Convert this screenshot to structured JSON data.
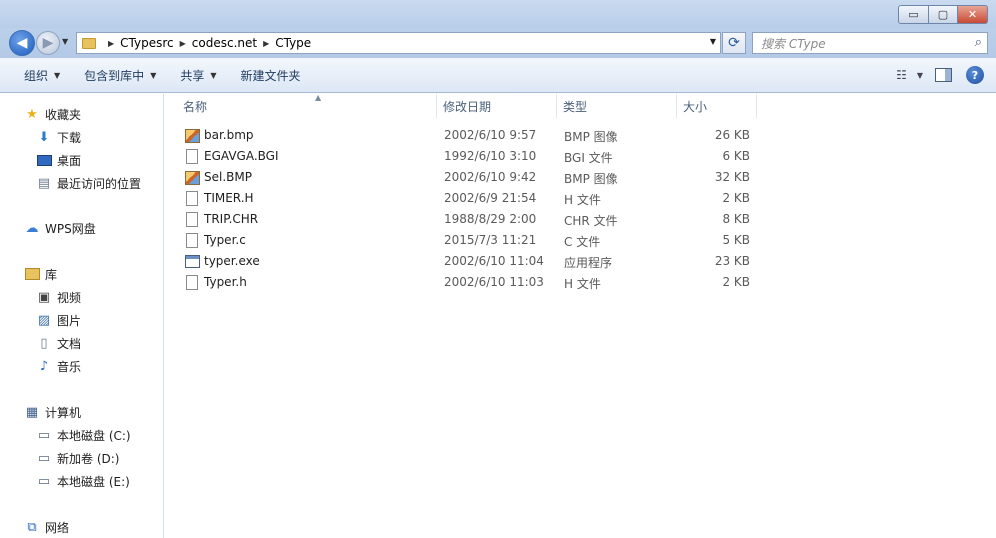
{
  "window": {
    "controls": {
      "minimize": "▭",
      "maximize": "▢",
      "close": "✕"
    }
  },
  "address": {
    "breadcrumbs": [
      "CTypesrc",
      "codesc.net",
      "CType"
    ],
    "search_placeholder": "搜索 CType"
  },
  "toolbar": {
    "organize": "组织",
    "include_in_library": "包含到库中",
    "share": "共享",
    "new_folder": "新建文件夹"
  },
  "nav": {
    "favorites": "收藏夹",
    "favorites_items": [
      "下载",
      "桌面",
      "最近访问的位置"
    ],
    "wps": "WPS网盘",
    "libraries": "库",
    "library_items": [
      "视频",
      "图片",
      "文档",
      "音乐"
    ],
    "computer": "计算机",
    "drives": [
      "本地磁盘 (C:)",
      "新加卷 (D:)",
      "本地磁盘 (E:)"
    ],
    "network": "网络"
  },
  "columns": {
    "name": "名称",
    "date": "修改日期",
    "type": "类型",
    "size": "大小"
  },
  "files": [
    {
      "name": "bar.bmp",
      "date": "2002/6/10 9:57",
      "type": "BMP 图像",
      "size": "26 KB",
      "icon": "bmp-icon"
    },
    {
      "name": "EGAVGA.BGI",
      "date": "1992/6/10 3:10",
      "type": "BGI 文件",
      "size": "6 KB",
      "icon": "file-icon"
    },
    {
      "name": "Sel.BMP",
      "date": "2002/6/10 9:42",
      "type": "BMP 图像",
      "size": "32 KB",
      "icon": "bmp-icon"
    },
    {
      "name": "TIMER.H",
      "date": "2002/6/9 21:54",
      "type": "H 文件",
      "size": "2 KB",
      "icon": "file-icon"
    },
    {
      "name": "TRIP.CHR",
      "date": "1988/8/29 2:00",
      "type": "CHR 文件",
      "size": "8 KB",
      "icon": "file-icon"
    },
    {
      "name": "Typer.c",
      "date": "2015/7/3 11:21",
      "type": "C 文件",
      "size": "5 KB",
      "icon": "file-icon"
    },
    {
      "name": "typer.exe",
      "date": "2002/6/10 11:04",
      "type": "应用程序",
      "size": "23 KB",
      "icon": "exe-icon"
    },
    {
      "name": "Typer.h",
      "date": "2002/6/10 11:03",
      "type": "H 文件",
      "size": "2 KB",
      "icon": "file-icon"
    }
  ]
}
